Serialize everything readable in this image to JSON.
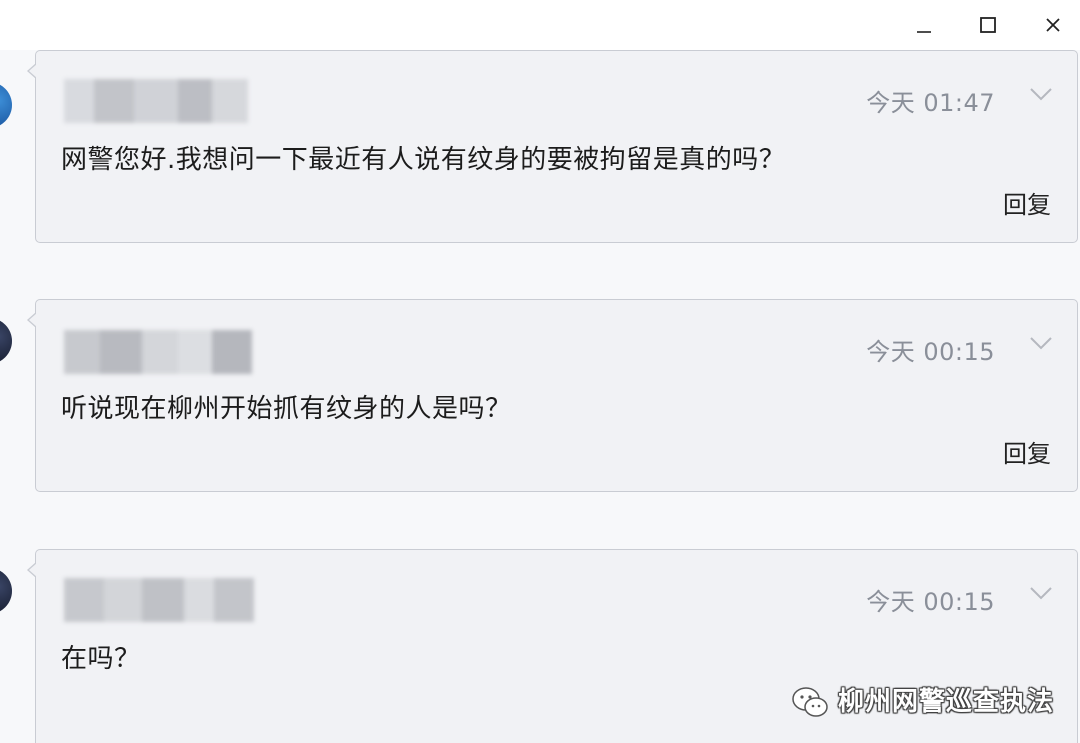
{
  "window_controls": {
    "minimize": "minimize",
    "maximize": "maximize",
    "close": "close"
  },
  "messages": [
    {
      "time": "今天 01:47",
      "text": "网警您好.我想问一下最近有人说有纹身的要被拘留是真的吗？",
      "reply_label": "回复"
    },
    {
      "time": "今天 00:15",
      "text": "听说现在柳州开始抓有纹身的人是吗？",
      "reply_label": "回复"
    },
    {
      "time": "今天 00:15",
      "text": "在吗？",
      "reply_label": ""
    }
  ],
  "watermark": {
    "text": "柳州网警巡查执法",
    "icon": "wechat-icon"
  },
  "colors": {
    "card_bg": "#f1f2f5",
    "card_border": "#c9ccd3",
    "time_text": "#8a8f99"
  }
}
